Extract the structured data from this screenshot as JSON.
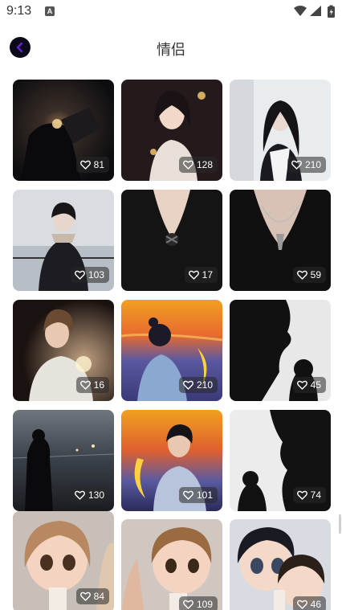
{
  "status_bar": {
    "time": "9:13",
    "notification_badge": "A",
    "icons": [
      "wifi-icon",
      "signal-icon",
      "battery-icon"
    ]
  },
  "header": {
    "title": "情侣",
    "back_icon": "chevron-left-icon"
  },
  "colors": {
    "accent": "#6a1fd1",
    "back_button_bg": "#0a0a1a",
    "badge_bg": "rgba(40,40,40,0.55)"
  },
  "grid": {
    "items": [
      {
        "likes": "81"
      },
      {
        "likes": "128"
      },
      {
        "likes": "210"
      },
      {
        "likes": "103"
      },
      {
        "likes": "17"
      },
      {
        "likes": "59"
      },
      {
        "likes": "16"
      },
      {
        "likes": "210"
      },
      {
        "likes": "45"
      },
      {
        "likes": "130"
      },
      {
        "likes": "101"
      },
      {
        "likes": "74"
      },
      {
        "likes": "84"
      },
      {
        "likes": "109"
      },
      {
        "likes": "46"
      }
    ]
  }
}
